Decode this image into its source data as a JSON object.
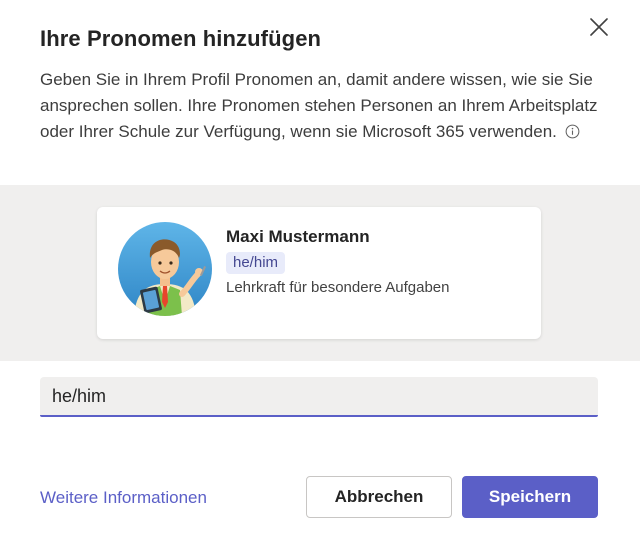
{
  "dialog": {
    "title": "Ihre Pronomen hinzufügen",
    "description": "Geben Sie in Ihrem Profil Pronomen an, damit andere wissen, wie sie Sie ansprechen sollen. Ihre Pronomen stehen Personen an Ihrem Arbeitsplatz oder Ihrer Schule zur Verfügung, wenn sie Microsoft 365 verwenden."
  },
  "profile_card": {
    "name": "Maxi Mustermann",
    "pronouns": "he/him",
    "role": "Lehrkraft für besondere Aufgaben"
  },
  "pronoun_input": {
    "value": "he/him"
  },
  "footer": {
    "more_info_link": "Weitere Informationen",
    "cancel_label": "Abbrechen",
    "save_label": "Speichern"
  },
  "icons": {
    "close": "close-icon",
    "info": "info-icon"
  },
  "colors": {
    "accent": "#5b5fc7",
    "badge_bg": "#e8ebfa",
    "badge_text": "#444791",
    "preview_bg": "#f0efee"
  }
}
